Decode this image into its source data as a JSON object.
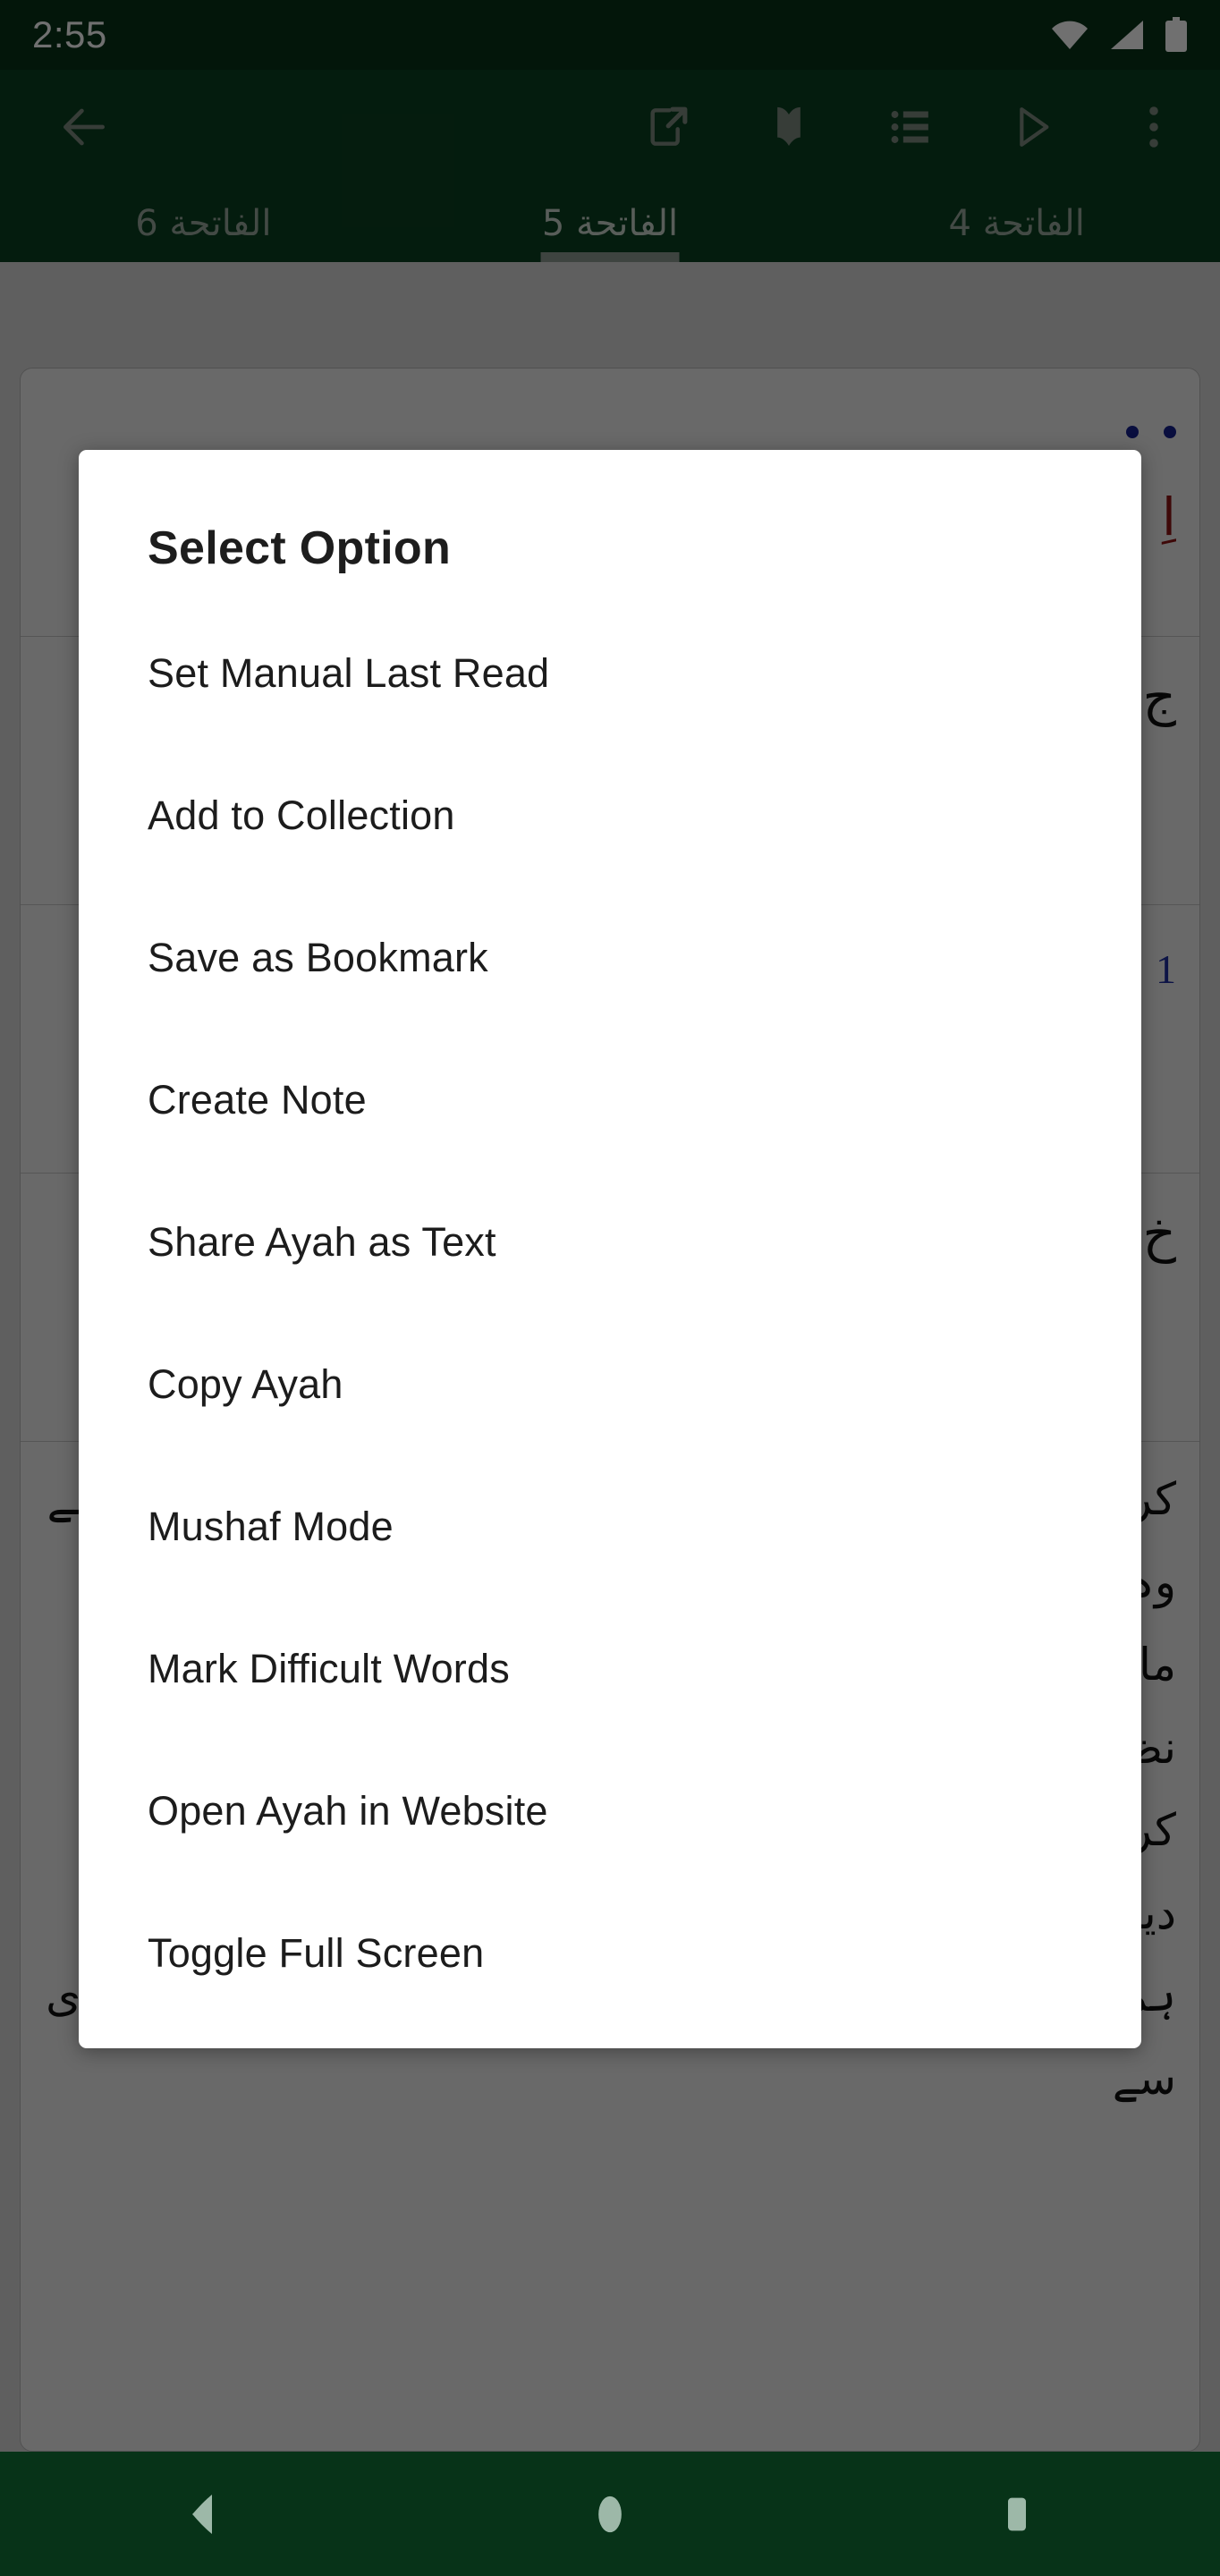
{
  "status_bar": {
    "clock": "2:55",
    "icons": [
      "wifi-icon",
      "cellular-signal-icon",
      "battery-icon"
    ]
  },
  "toolbar": {
    "back_label": "Back",
    "actions": [
      {
        "name": "share-icon",
        "label": "Share"
      },
      {
        "name": "quran-book-icon",
        "label": "Quran"
      },
      {
        "name": "list-icon",
        "label": "List"
      },
      {
        "name": "play-icon",
        "label": "Play"
      },
      {
        "name": "overflow-menu-icon",
        "label": "More options"
      }
    ]
  },
  "tabs": [
    {
      "label": "الفاتحة 6",
      "active": false
    },
    {
      "label": "الفاتحة 5",
      "active": true
    },
    {
      "label": "الفاتحة 4",
      "active": false
    }
  ],
  "dialog": {
    "title": "Select Option",
    "items": [
      "Set Manual Last Read",
      "Add to Collection",
      "Save as Bookmark",
      "Create Note",
      "Share Ayah as Text",
      "Copy Ayah",
      "Mushaf Mode",
      "Mark Difficult Words",
      "Open Ayah in Website",
      "Toggle Full Screen"
    ]
  },
  "background_content": {
    "arabic_fragment_red": "اِ",
    "arabic_fragment_1": "خ",
    "arabic_fragment_2": "ج",
    "ayah_number": "1",
    "urdu_lines": [
      "کر دیا گیا ہے ان ہی دونوں سے سمجھ ان دونوں راہ پا لیا ہے وہ",
      "ما فوق الاسباب اور ما تحت الاسباب استعانت میں فرق کو نظر انداز",
      "کر کے عوام کو مغالطے میں ڈال دیتے ہیں اور کہتے ہیں کہ دیکھو",
      "ہم بیمار ہو جاتے ہیں تو ڈاکٹر سے مدد حاصل کرتے ہیں بیوی سے"
    ]
  },
  "nav_bar": {
    "buttons": [
      {
        "name": "android-back-button",
        "label": "Back"
      },
      {
        "name": "android-home-button",
        "label": "Home"
      },
      {
        "name": "android-recents-button",
        "label": "Recents"
      }
    ]
  },
  "colors": {
    "status_bar_bg": "#073318",
    "app_bar_bg": "#0b4020",
    "icon_gray": "#7d8b80",
    "tab_indicator": "#8e9b91",
    "dialog_bg": "#ffffff",
    "dialog_text": "#1c1c1c",
    "scrim": "rgba(0,0,0,0.56)",
    "nav_icon": "#9db8a8",
    "accent_red": "#8e1414",
    "accent_blue": "#16208e"
  }
}
